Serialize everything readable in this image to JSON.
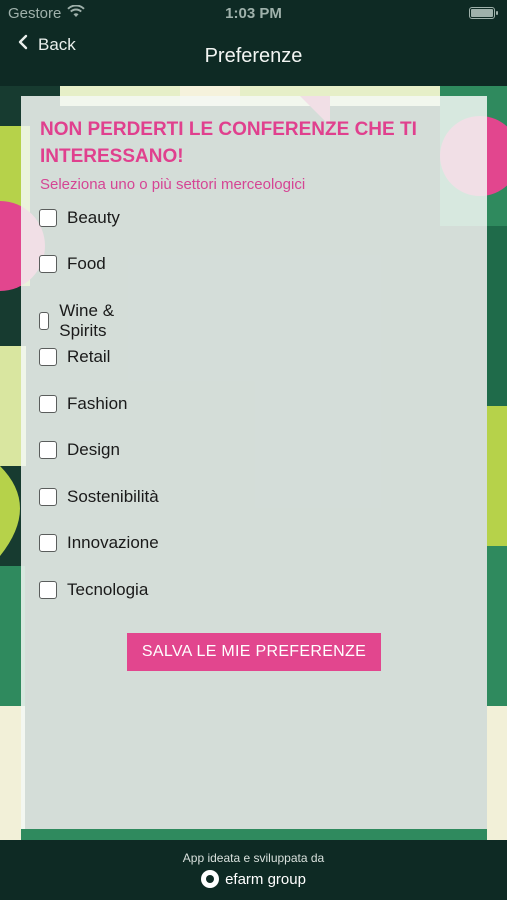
{
  "status_bar": {
    "carrier": "Gestore",
    "time": "1:03 PM",
    "wifi_icon": "wifi-icon",
    "battery_icon": "battery-icon"
  },
  "nav": {
    "back_label": "Back",
    "title": "Preferenze"
  },
  "card": {
    "heading": "NON PERDERTI LE CONFERENZE CHE TI INTERESSANO!",
    "subheading": "Seleziona uno o più settori merceologici",
    "options": [
      {
        "label": "Beauty",
        "checked": false
      },
      {
        "label": "Food",
        "checked": false
      },
      {
        "label": "Wine & Spirits",
        "checked": false
      },
      {
        "label": "Retail",
        "checked": false
      },
      {
        "label": "Fashion",
        "checked": false
      },
      {
        "label": "Design",
        "checked": false
      },
      {
        "label": "Sostenibilità",
        "checked": false
      },
      {
        "label": "Innovazione",
        "checked": false
      },
      {
        "label": "Tecnologia",
        "checked": false
      }
    ],
    "save_label": "SALVA LE MIE PREFERENZE"
  },
  "footer": {
    "credit": "App ideata e sviluppata da",
    "brand": "efarm group"
  },
  "colors": {
    "accent": "#e2468e",
    "heading": "#e0408e",
    "dark_bg": "#0e2a24"
  }
}
